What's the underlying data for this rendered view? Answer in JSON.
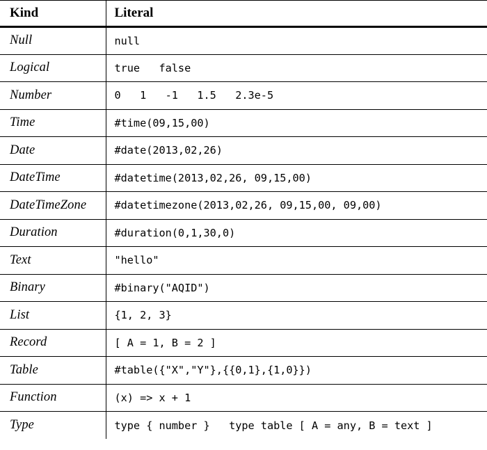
{
  "table": {
    "columns": [
      {
        "key": "kind",
        "label": "Kind"
      },
      {
        "key": "literal",
        "label": "Literal"
      }
    ],
    "rows": [
      {
        "kind": "Null",
        "literal": "null"
      },
      {
        "kind": "Logical",
        "literal": "true   false"
      },
      {
        "kind": "Number",
        "literal": "0   1   -1   1.5   2.3e-5"
      },
      {
        "kind": "Time",
        "literal": "#time(09,15,00)"
      },
      {
        "kind": "Date",
        "literal": "#date(2013,02,26)"
      },
      {
        "kind": "DateTime",
        "literal": "#datetime(2013,02,26, 09,15,00)"
      },
      {
        "kind": "DateTimeZone",
        "literal": "#datetimezone(2013,02,26, 09,15,00, 09,00)"
      },
      {
        "kind": "Duration",
        "literal": "#duration(0,1,30,0)"
      },
      {
        "kind": "Text",
        "literal": "\"hello\""
      },
      {
        "kind": "Binary",
        "literal": "#binary(\"AQID\")"
      },
      {
        "kind": "List",
        "literal": "{1, 2, 3}"
      },
      {
        "kind": "Record",
        "literal": "[ A = 1, B = 2 ]"
      },
      {
        "kind": "Table",
        "literal": "#table({\"X\",\"Y\"},{{0,1},{1,0}})"
      },
      {
        "kind": "Function",
        "literal": "(x) => x + 1"
      },
      {
        "kind": "Type",
        "literal": "type { number }   type table [ A = any, B = text ]"
      }
    ]
  },
  "colors": {
    "text": "#000000",
    "background": "#ffffff",
    "rule": "#000000"
  }
}
